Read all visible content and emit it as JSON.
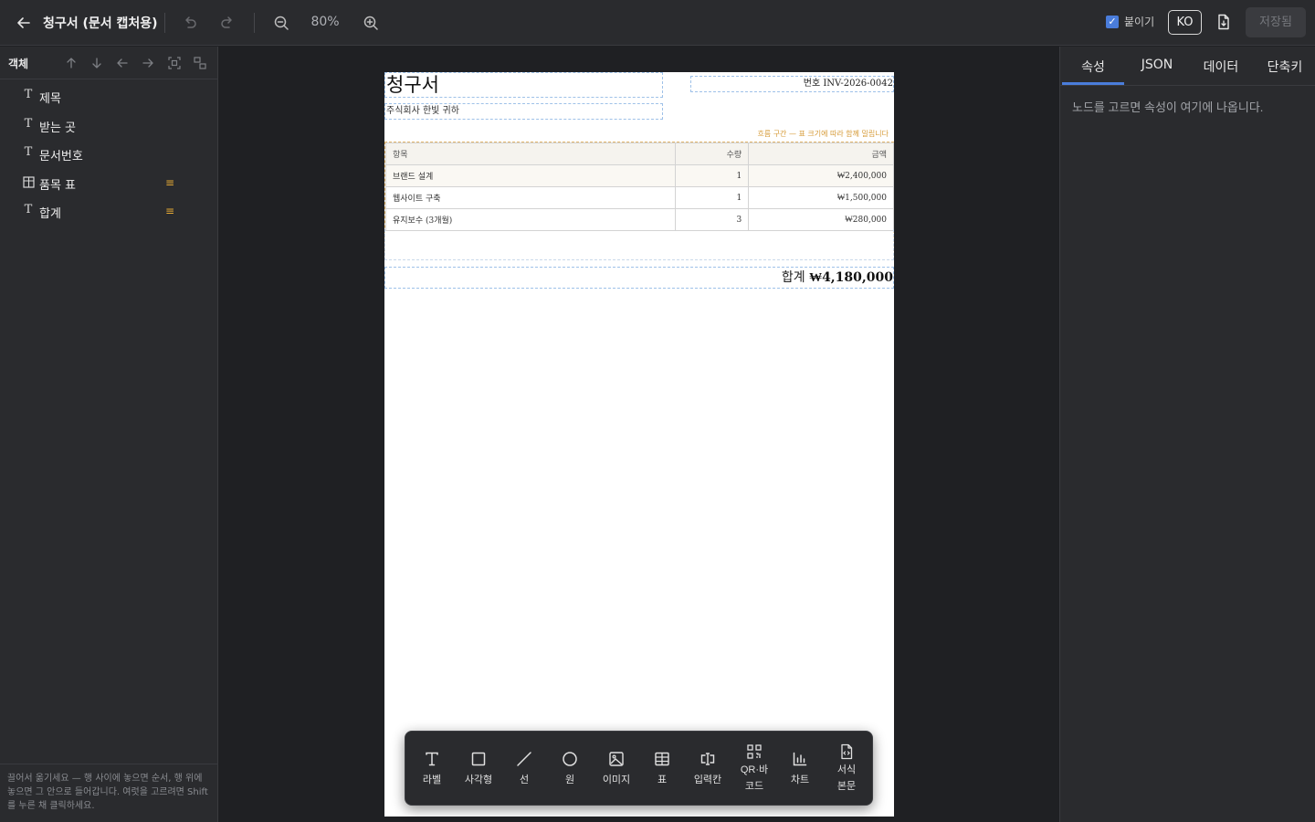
{
  "topbar": {
    "back_icon": "arrow-left-icon",
    "title": "청구서 (문서 캡처용)",
    "zoom": "80%",
    "snap_label": "붙이기",
    "snap_checked": true,
    "lang": "KO",
    "save_label": "저장됨"
  },
  "left_panel": {
    "title": "객체",
    "tools": [
      "arrow-up-icon",
      "arrow-down-icon",
      "arrow-left-icon",
      "arrow-right-icon",
      "select-group-icon",
      "ungroup-icon"
    ],
    "items": [
      {
        "icon": "text-icon",
        "label": "제목",
        "handle": false
      },
      {
        "icon": "text-icon",
        "label": "받는 곳",
        "handle": false
      },
      {
        "icon": "text-icon",
        "label": "문서번호",
        "handle": false
      },
      {
        "icon": "table-icon",
        "label": "품목 표",
        "handle": true
      },
      {
        "icon": "text-icon",
        "label": "합계",
        "handle": true
      }
    ],
    "footer": "끌어서 옮기세요 — 행 사이에 놓으면 순서, 행 위에 놓으면 그 안으로 들어갑니다. 여럿을 고르려면 Shift를 누른 채 클릭하세요."
  },
  "document": {
    "title": "청구서",
    "invoice_no": "번호 INV-2026-0042",
    "recipient": "주식회사 한빛 귀하",
    "flow_note": "흐름 구간 — 표 크기에 따라 함께 밀립니다",
    "table": {
      "headers": [
        "항목",
        "수량",
        "금액"
      ],
      "rows": [
        [
          "브랜드 설계",
          "1",
          "₩2,400,000"
        ],
        [
          "웹사이트 구축",
          "1",
          "₩1,500,000"
        ],
        [
          "유지보수 (3개월)",
          "3",
          "₩280,000"
        ]
      ]
    },
    "total_label": "합계",
    "total_value": "₩4,180,000"
  },
  "toolbox": [
    {
      "icon": "text-icon",
      "label": "라벨"
    },
    {
      "icon": "rectangle-icon",
      "label": "사각형"
    },
    {
      "icon": "line-icon",
      "label": "선"
    },
    {
      "icon": "circle-icon",
      "label": "원"
    },
    {
      "icon": "image-icon",
      "label": "이미지"
    },
    {
      "icon": "table-icon",
      "label": "표"
    },
    {
      "icon": "input-field-icon",
      "label": "입력칸"
    },
    {
      "icon": "qr-code-icon",
      "label_line1": "QR·바",
      "label_line2": "코드"
    },
    {
      "icon": "chart-icon",
      "label": "차트"
    },
    {
      "icon": "template-icon",
      "label_line1": "서식",
      "label_line2": "본문"
    }
  ],
  "right_panel": {
    "tabs": [
      "속성",
      "JSON",
      "데이터",
      "단축키"
    ],
    "active_tab": "속성",
    "hint": "노드를 고르면 속성이 여기에 나옵니다."
  },
  "colors": {
    "accent": "#4a7ddb",
    "handle": "#e3a834",
    "flow_note": "#d69a36"
  }
}
